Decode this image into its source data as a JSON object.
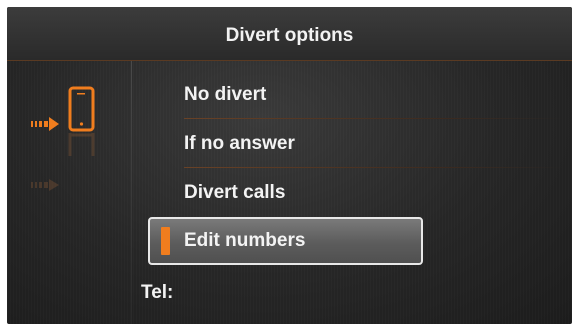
{
  "header": {
    "title": "Divert options"
  },
  "menu": {
    "items": [
      {
        "label": "No divert"
      },
      {
        "label": "If no answer"
      },
      {
        "label": "Divert calls"
      },
      {
        "label": "Edit numbers"
      }
    ],
    "selected_index": 3
  },
  "footer": {
    "tel_label": "Tel:"
  },
  "icons": {
    "phone": "mobile-phone-icon",
    "arrow": "incoming-arrow-icon"
  },
  "colors": {
    "accent": "#f07d1e",
    "background": "#262626",
    "text": "#f3f3f3"
  }
}
